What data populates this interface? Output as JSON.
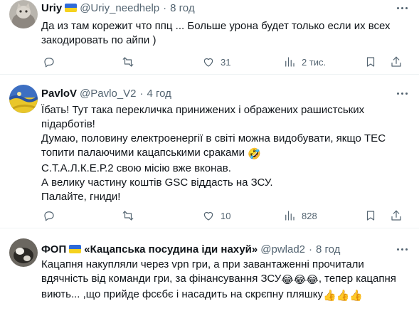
{
  "posts": [
    {
      "name": "Uriy",
      "handle": "@Uriy_needhelp",
      "time": "8 год",
      "lines": [
        "Да из там корежит что ппц ... Больше урона будет только если их всех",
        "закодировать по айпи )"
      ],
      "actions": {
        "replies": "",
        "reposts": "",
        "likes": "31",
        "views": "2 тис."
      }
    },
    {
      "name": "PavloV",
      "handle": "@Pavlo_V2",
      "time": "4 год",
      "lines": [
        "Їбать! Тут така перекличка принижених і ображених рашистських",
        "підарботів!",
        "Думаю, половину електроенергії в світі можна видобувати, якщо ТЕС",
        "топити палаючими кацапськими сраками",
        "С.Т.А.Л.К.Е.Р.2 свою місію вже вконав.",
        "А велику частину коштів GSC віддасть на ЗСУ.",
        "Палайте, гниди!"
      ],
      "emoji": "🤣",
      "actions": {
        "replies": "",
        "reposts": "",
        "likes": "10",
        "views": "828"
      }
    },
    {
      "name_prefix": "ФОП",
      "name": "«Кацапська посудина іди нахуй»",
      "handle": "@pwlad2",
      "time": "8 год",
      "lines": [
        "Кацапня накупляли через vpn гри, а при завантаженні прочитали",
        "вдячність від команди гри, за фінансування ЗСУ",
        ", тепер кацапня",
        "виють... ,що прийде фсєбє і насадить на скрєпну пляшку"
      ],
      "emoji_laugh": "😂😂😂",
      "emoji_thumbs": "👍👍👍"
    }
  ],
  "icons": [
    "reply-icon",
    "repost-icon",
    "like-icon",
    "views-icon",
    "bookmark-icon",
    "share-icon",
    "more-icon"
  ],
  "colors": {
    "text": "#0f1419",
    "muted": "#536471",
    "divider": "#eff3f4",
    "flag_blue": "#2f6bd8",
    "flag_yellow": "#f5d21f"
  }
}
